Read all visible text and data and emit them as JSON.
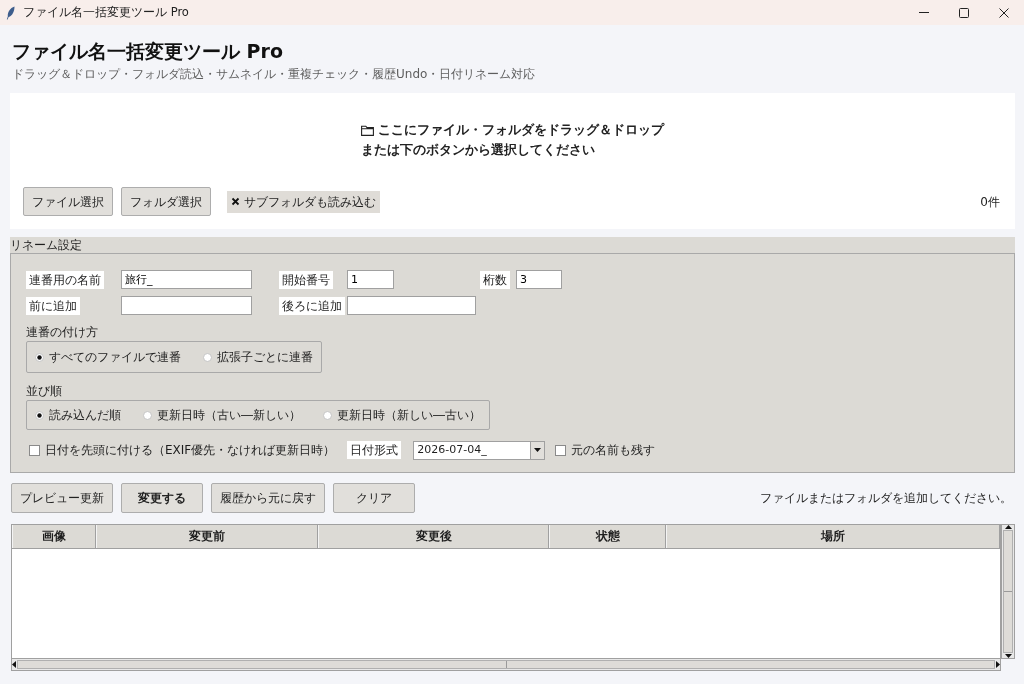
{
  "window": {
    "title": "ファイル名一括変更ツール Pro"
  },
  "header": {
    "title": "ファイル名一括変更ツール Pro",
    "subtitle": "ドラッグ＆ドロップ・フォルダ読込・サムネイル・重複チェック・履歴Undo・日付リネーム対応"
  },
  "drop_zone": {
    "message": [
      "ここにファイル・フォルダをドラッグ＆ドロップ",
      "または下のボタンから選択してください"
    ],
    "buttons": [
      "ファイル選択",
      "フォルダ選択"
    ],
    "include_subfolders": {
      "label": "サブフォルダも読み込む",
      "checked": true
    },
    "count": "0件"
  },
  "rename_settings": {
    "title": "リネーム設定",
    "field_rows": [
      [
        {
          "label": "連番用の名前",
          "value": "旅行_"
        },
        {
          "label": "開始番号",
          "value": "1"
        },
        {
          "label": "桁数",
          "value": "3"
        }
      ],
      [
        {
          "label": "前に追加"
        },
        {
          "label": "後ろに追加"
        }
      ]
    ],
    "numbering": {
      "label": "連番の付け方",
      "options": [
        {
          "label": "すべてのファイルで連番",
          "selected": true
        },
        {
          "label": "拡張子ごとに連番",
          "selected": false
        }
      ]
    },
    "sort_order": {
      "label": "並び順",
      "options": [
        {
          "label": "読み込んだ順",
          "selected": true
        },
        {
          "label": "更新日時（古い―新しい）",
          "selected": false
        },
        {
          "label": "更新日時（新しい―古い）",
          "selected": false
        }
      ]
    },
    "date_prefix": {
      "label": "日付を先頭に付ける（EXIF優先・なければ更新日時）",
      "checked": false
    },
    "date_format": {
      "label": "日付形式",
      "value": "2026-07-04_"
    },
    "keep_original": {
      "label": "元の名前も残す",
      "checked": false
    }
  },
  "actions": [
    {
      "label": "プレビュー更新",
      "primary": false
    },
    {
      "label": "変更する",
      "primary": true
    },
    {
      "label": "履歴から元に戻す",
      "primary": false
    },
    {
      "label": "クリア",
      "primary": false
    }
  ],
  "status_message": "ファイルまたはフォルダを追加してください。",
  "table": {
    "columns": [
      "画像",
      "変更前",
      "変更後",
      "状態",
      "場所"
    ]
  }
}
